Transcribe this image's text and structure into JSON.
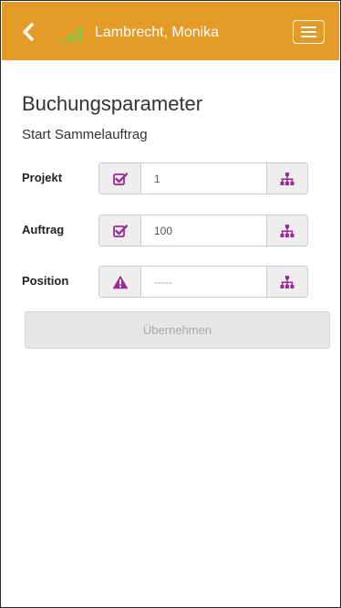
{
  "header": {
    "user_name": "Lambrecht, Monika",
    "background_color": "#e49a27",
    "back_icon": "chevron-left-icon",
    "signal_icon": "signal-bars-icon",
    "menu_icon": "hamburger-menu-icon"
  },
  "page": {
    "title": "Buchungsparameter",
    "subtitle": "Start Sammelauftrag"
  },
  "rows": [
    {
      "label": "Projekt",
      "status": "checked",
      "status_icon": "checkbox-checked-icon",
      "value": "1",
      "placeholder": ""
    },
    {
      "label": "Auftrag",
      "status": "checked",
      "status_icon": "checkbox-checked-icon",
      "value": "100",
      "placeholder": ""
    },
    {
      "label": "Position",
      "status": "warning",
      "status_icon": "warning-icon",
      "value": "",
      "placeholder": "-----"
    }
  ],
  "apply_button": {
    "label": "Übernehmen",
    "disabled": true
  },
  "colors": {
    "accent": "#e49a27",
    "icon_purple": "#a0289a",
    "signal_green": "#8dc63f"
  }
}
